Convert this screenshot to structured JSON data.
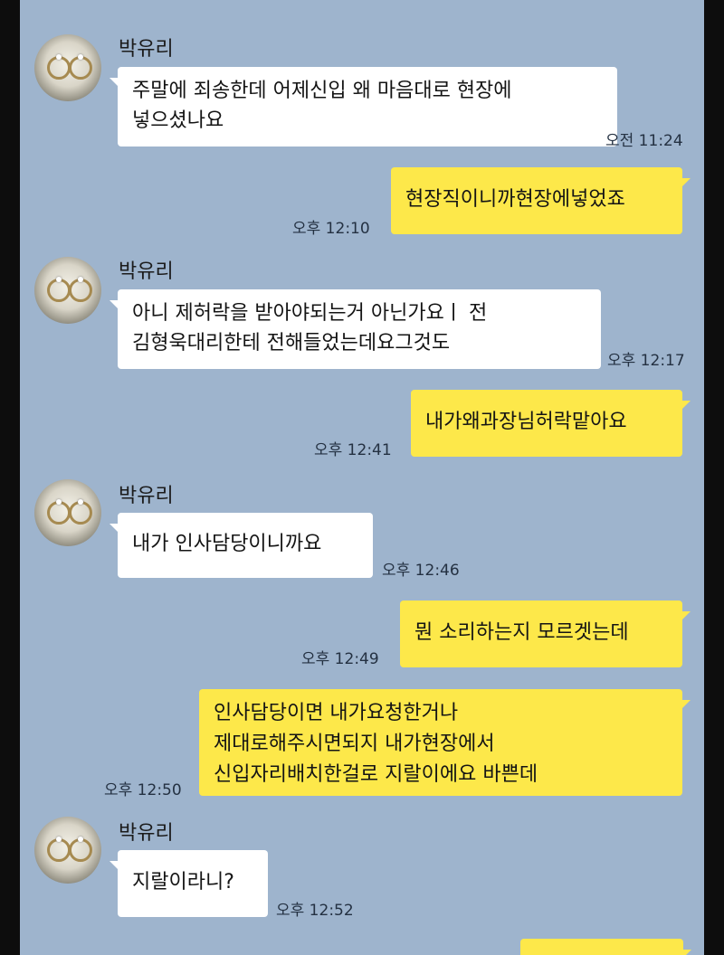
{
  "colors": {
    "chat_background": "#9eb4cd",
    "incoming_bubble": "#ffffff",
    "outgoing_bubble": "#fde84a"
  },
  "icons": {
    "avatar": "profile-photo-avatar"
  },
  "messages": [
    {
      "sender": "박유리",
      "lines": [
        "주말에 죄송한데 어제신입 왜 마음대로 현장에",
        "넣으셨나요"
      ],
      "time": "오전 11:24"
    },
    {
      "lines": [
        "현장직이니까현장에넣었죠"
      ],
      "time": "오후 12:10"
    },
    {
      "sender": "박유리",
      "lines": [
        "아니 제허락을 받아야되는거 아닌가요ㅣ 전",
        "김형욱대리한테 전해들었는데요그것도"
      ],
      "time": "오후 12:17"
    },
    {
      "lines": [
        "내가왜과장님허락맡아요"
      ],
      "time": "오후 12:41"
    },
    {
      "sender": "박유리",
      "lines": [
        "내가 인사담당이니까요"
      ],
      "time": "오후 12:46"
    },
    {
      "lines": [
        "뭔 소리하는지 모르겟는데"
      ],
      "time": "오후 12:49"
    },
    {
      "lines": [
        "인사담당이면 내가요청한거나",
        "제대로해주시면되지 내가현장에서",
        "신입자리배치한걸로 지랄이에요 바쁜데"
      ],
      "time": "오후 12:50"
    },
    {
      "sender": "박유리",
      "lines": [
        "지랄이라니?"
      ],
      "time": "오후 12:52"
    }
  ]
}
